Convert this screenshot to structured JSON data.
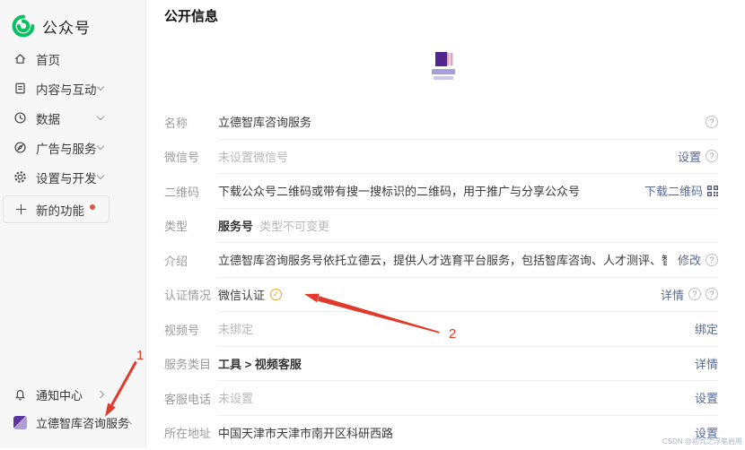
{
  "app": {
    "logo_text": "公众号"
  },
  "sidebar": {
    "menu": [
      {
        "label": "首页",
        "icon": "home-icon",
        "chevron": false
      },
      {
        "label": "内容与互动",
        "icon": "content-icon",
        "chevron": true
      },
      {
        "label": "数据",
        "icon": "data-icon",
        "chevron": true
      },
      {
        "label": "广告与服务",
        "icon": "ads-icon",
        "chevron": true
      },
      {
        "label": "设置与开发",
        "icon": "settings-icon",
        "chevron": true
      }
    ],
    "new_feature_label": "新的功能",
    "notification_label": "通知中心",
    "account_label": "立德智库咨询服务"
  },
  "header": {
    "title": "公开信息"
  },
  "form": {
    "rows": [
      {
        "label": "名称",
        "value": "立德智库咨询服务",
        "style": "normal",
        "actions": [
          {
            "kind": "help"
          }
        ]
      },
      {
        "label": "微信号",
        "value": "未设置微信号",
        "style": "muted",
        "actions": [
          {
            "kind": "link",
            "text": "设置",
            "name": "set-wechat-id-link"
          },
          {
            "kind": "help"
          }
        ]
      },
      {
        "label": "二维码",
        "value": "下载公众号二维码或带有搜一搜标识的二维码，用于推广与分享公众号",
        "style": "normal",
        "actions": [
          {
            "kind": "link",
            "text": "下载二维码",
            "name": "download-qrcode-link"
          },
          {
            "kind": "qr"
          }
        ]
      },
      {
        "label": "类型",
        "value": "服务号",
        "style": "bold",
        "value_suffix": "类型不可变更",
        "actions": []
      },
      {
        "label": "介绍",
        "value": "立德智库咨询服务号依托立德云，提供人才选育平台服务，包括智库咨询、人才测评、智能考试、培训等服务功能",
        "style": "normal",
        "actions": [
          {
            "kind": "link",
            "text": "修改",
            "name": "edit-intro-link"
          },
          {
            "kind": "help"
          }
        ]
      },
      {
        "label": "认证情况",
        "value": "微信认证",
        "style": "normal",
        "badge": "verified",
        "actions": [
          {
            "kind": "link",
            "text": "详情",
            "name": "verification-detail-link"
          },
          {
            "kind": "help"
          },
          {
            "kind": "help"
          }
        ]
      },
      {
        "label": "视频号",
        "value": "未绑定",
        "style": "muted",
        "actions": [
          {
            "kind": "link",
            "text": "绑定",
            "name": "bind-channels-link"
          }
        ]
      },
      {
        "label": "服务类目",
        "value": "工具 > 视频客服",
        "style": "bold",
        "actions": [
          {
            "kind": "link",
            "text": "详情",
            "name": "category-detail-link"
          }
        ]
      },
      {
        "label": "客服电话",
        "value": "未设置",
        "style": "muted",
        "actions": [
          {
            "kind": "link",
            "text": "设置",
            "name": "set-phone-link"
          }
        ]
      },
      {
        "label": "所在地址",
        "value": "中国天津市天津市南开区科研西路",
        "style": "normal",
        "actions": [
          {
            "kind": "link",
            "text": "设置",
            "name": "set-address-link"
          }
        ]
      }
    ]
  },
  "annotations": {
    "label1": "1",
    "label2": "2"
  },
  "watermark": "CSDN @初九之浮笔启用",
  "colors": {
    "brand_green": "#07c160",
    "link_blue": "#576b95",
    "badge_orange": "#f5a623",
    "annotation_red": "#e23a2a",
    "sidebar_bg": "#f7f7f8"
  }
}
